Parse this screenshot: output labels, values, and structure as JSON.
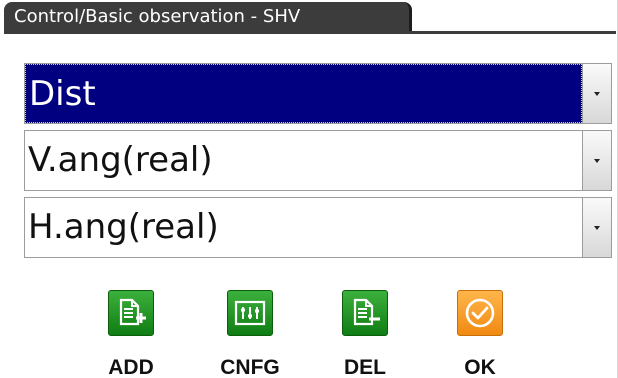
{
  "window": {
    "title": "Control/Basic observation - SHV"
  },
  "fields": [
    {
      "value": "Dist",
      "selected": true
    },
    {
      "value": "V.ang(real)",
      "selected": false
    },
    {
      "value": "H.ang(real)",
      "selected": false
    }
  ],
  "buttons": {
    "add": {
      "label": "ADD",
      "icon": "document-add-icon",
      "color": "#1e9a22"
    },
    "cnfg": {
      "label": "CNFG",
      "icon": "configuration-icon",
      "color": "#1e9a22"
    },
    "del": {
      "label": "DEL",
      "icon": "document-delete-icon",
      "color": "#1e9a22"
    },
    "ok": {
      "label": "OK",
      "icon": "check-circle-icon",
      "color": "#f59a22"
    }
  },
  "colors": {
    "title_bar": "#3c3c3c",
    "selection": "#000080",
    "action_green": "#1e9a22",
    "ok_orange": "#f59a22"
  }
}
